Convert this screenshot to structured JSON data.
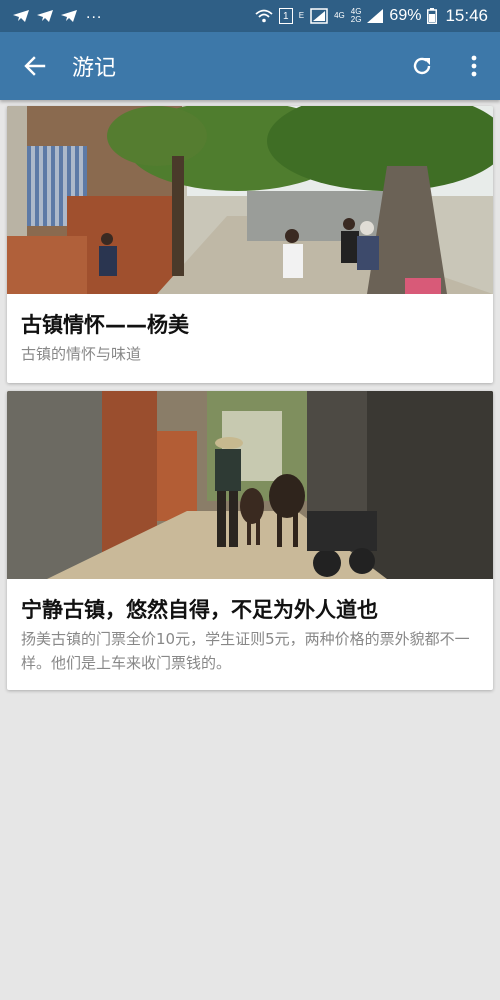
{
  "status_bar": {
    "left_dots": "...",
    "net_e": "E",
    "sim_box": "1",
    "net_4g_a": "4G",
    "net_4g_b": "4G",
    "net_2g": "2G",
    "battery": "69%",
    "time": "15:46"
  },
  "app_bar": {
    "title": "游记"
  },
  "cards": [
    {
      "title": "古镇情怀——杨美",
      "subtitle": "古镇的情怀与味道"
    },
    {
      "title": "宁静古镇，悠然自得，不足为外人道也",
      "subtitle": "扬美古镇的门票全价10元，学生证则5元，两种价格的票外貌都不一样。他们是上车来收门票钱的。"
    }
  ],
  "colors": {
    "status_bar": "#2f5f86",
    "app_bar": "#3d78a9",
    "background": "#e6e6e6"
  }
}
